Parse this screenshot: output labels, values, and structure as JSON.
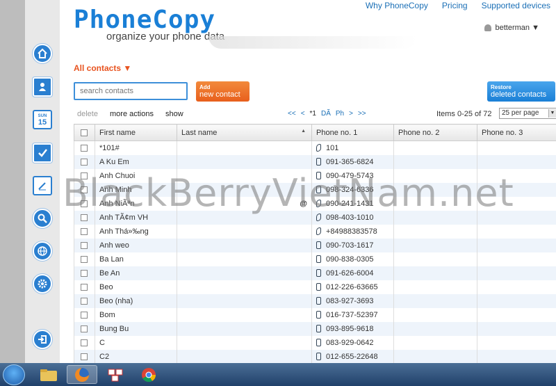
{
  "header": {
    "logo": "PhoneCopy",
    "tagline": "organize your phone data",
    "links": [
      "Why PhoneCopy",
      "Pricing",
      "Supported devices"
    ],
    "user": "betterman ▼"
  },
  "sidebar": {
    "icons": [
      "home-icon",
      "contacts-icon",
      "calendar-icon",
      "tasks-icon",
      "notes-icon",
      "search-icon",
      "globe-icon",
      "settings-icon",
      "logout-icon"
    ],
    "calendar_day": "SUN",
    "calendar_date": "15"
  },
  "filter": {
    "label": "All contacts ▼"
  },
  "search": {
    "placeholder": "search contacts"
  },
  "add_button": {
    "small": "Add",
    "big": "new contact"
  },
  "restore_button": {
    "small": "Restore",
    "big": "deleted contacts"
  },
  "toolbar": {
    "delete": "delete",
    "more_actions": "more actions",
    "show": "show",
    "pager": [
      "<<",
      "<",
      "*1",
      "DÃ",
      "Ph",
      ">",
      ">>"
    ],
    "items": "Items 0-25 of 72",
    "per_page": "25 per page"
  },
  "table": {
    "headers": [
      "First name",
      "Last name",
      "Phone no. 1",
      "Phone no. 2",
      "Phone no. 3"
    ],
    "rows": [
      {
        "first": "*101#",
        "last": "",
        "phone": "101",
        "icon": "handset"
      },
      {
        "first": "A Ku Em",
        "last": "",
        "phone": "091-365-6824",
        "icon": "mobile"
      },
      {
        "first": "Anh Chuoi",
        "last": "",
        "phone": "090-479-5743",
        "icon": "mobile"
      },
      {
        "first": "Anh Minh",
        "last": "",
        "phone": "098-324-6336",
        "icon": "mobile"
      },
      {
        "first": "Anh NiÃªn",
        "last": "@",
        "phone": "090-241-1431",
        "icon": "handset"
      },
      {
        "first": "Anh TÃ¢m VH",
        "last": "",
        "phone": "098-403-1010",
        "icon": "handset"
      },
      {
        "first": "Anh Thá»‰ng",
        "last": "",
        "phone": "+84988383578",
        "icon": "handset"
      },
      {
        "first": "Anh weo",
        "last": "",
        "phone": "090-703-1617",
        "icon": "mobile"
      },
      {
        "first": "Ba Lan",
        "last": "",
        "phone": "090-838-0305",
        "icon": "mobile"
      },
      {
        "first": "Be An",
        "last": "",
        "phone": "091-626-6004",
        "icon": "mobile"
      },
      {
        "first": "Beo",
        "last": "",
        "phone": "012-226-63665",
        "icon": "mobile"
      },
      {
        "first": "Beo (nha)",
        "last": "",
        "phone": "083-927-3693",
        "icon": "mobile"
      },
      {
        "first": "Bom",
        "last": "",
        "phone": "016-737-52397",
        "icon": "mobile"
      },
      {
        "first": "Bung Bu",
        "last": "",
        "phone": "093-895-9618",
        "icon": "mobile"
      },
      {
        "first": "C",
        "last": "",
        "phone": "083-929-0642",
        "icon": "mobile"
      },
      {
        "first": "C2",
        "last": "",
        "phone": "012-655-22648",
        "icon": "mobile"
      }
    ]
  },
  "watermark": "BlackBerryVietNam.net",
  "taskbar": {
    "items": [
      "start-button",
      "explorer-icon",
      "firefox-icon",
      "unikey-icon",
      "chrome-icon"
    ]
  }
}
